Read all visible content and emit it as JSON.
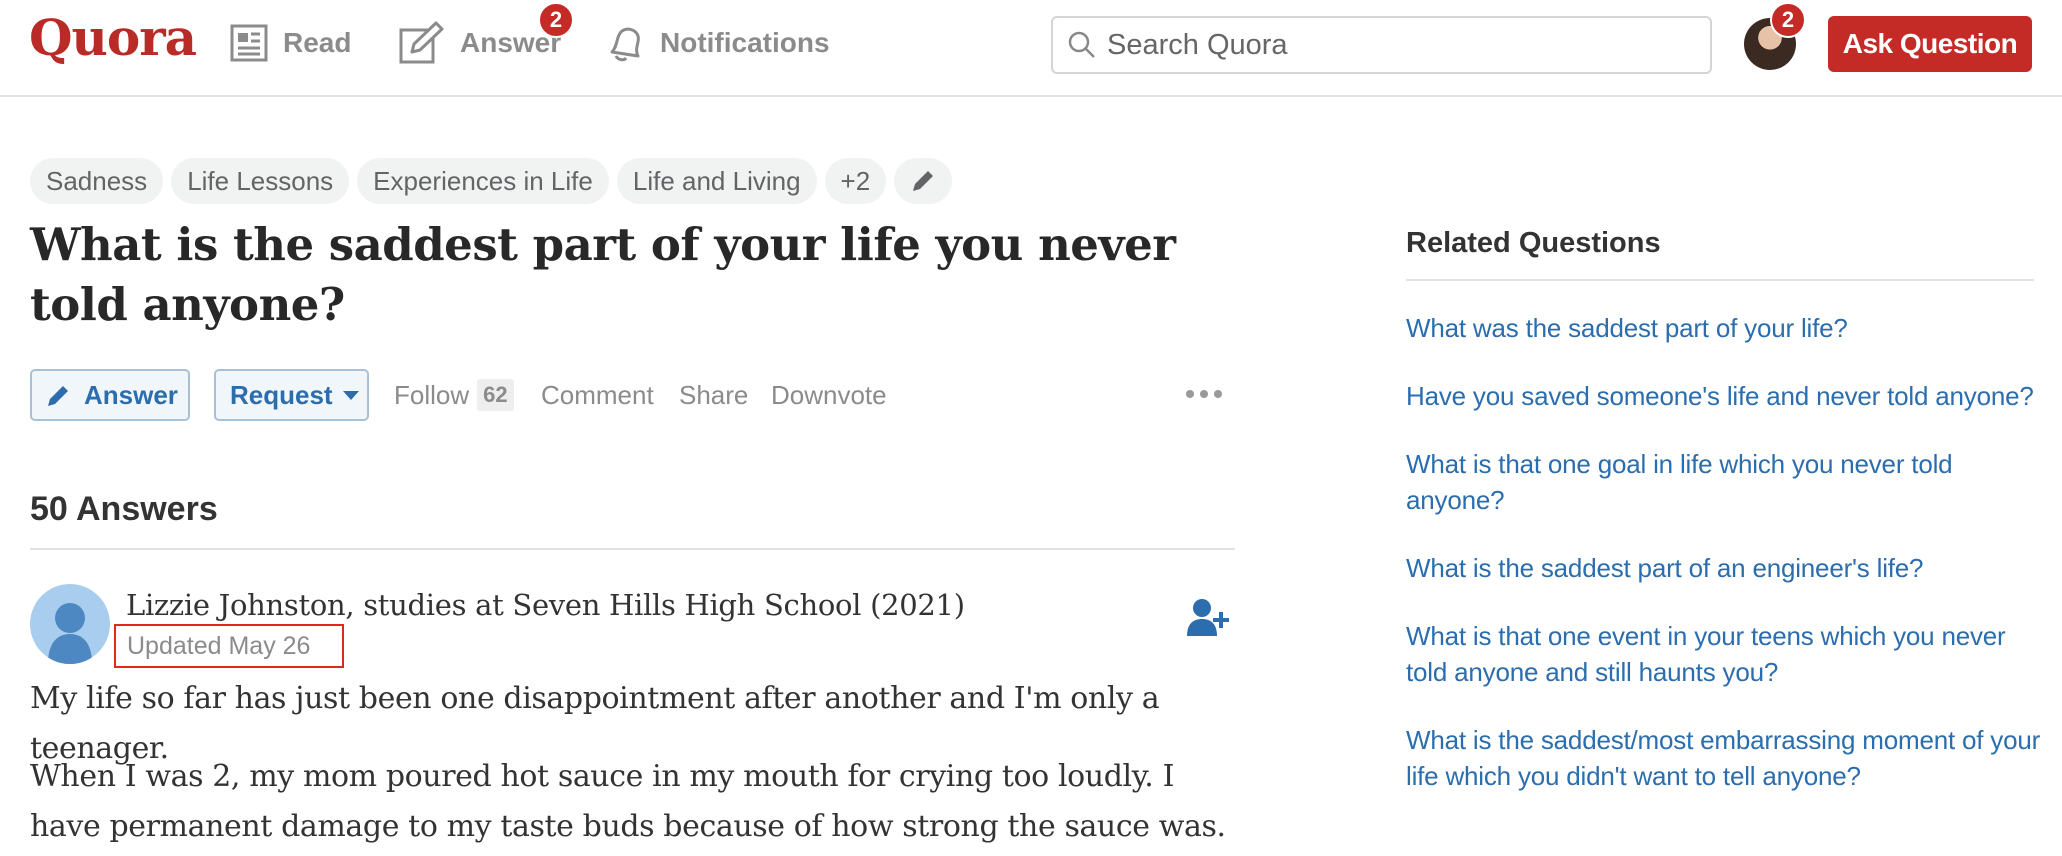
{
  "header": {
    "logo": "Quora",
    "nav": {
      "read": "Read",
      "answer": "Answer",
      "answer_badge": "2",
      "notifications": "Notifications"
    },
    "search_placeholder": "Search Quora",
    "avatar_badge": "2",
    "ask_button": "Ask Question"
  },
  "topics": [
    "Sadness",
    "Life Lessons",
    "Experiences in Life",
    "Life and Living",
    "+2"
  ],
  "question": {
    "title": "What is the saddest part of your life you never told anyone?",
    "actions": {
      "answer": "Answer",
      "request": "Request",
      "follow": "Follow",
      "follow_count": "62",
      "comment": "Comment",
      "share": "Share",
      "downvote": "Downvote"
    },
    "answers_count": "50 Answers"
  },
  "answer": {
    "author": "Lizzie Johnston, studies at Seven Hills High School (2021)",
    "updated": "Updated May 26",
    "paragraphs": [
      "My life so far has just been one disappointment after another and I'm only a teenager.",
      "When I was 2, my mom poured hot sauce in my mouth for crying too loudly. I have permanent damage to my taste buds because of how strong the sauce was."
    ]
  },
  "sidebar": {
    "title": "Related Questions",
    "items": [
      "What was the saddest part of your life?",
      "Have you saved someone's life and never told anyone?",
      "What is that one goal in life which you never told anyone?",
      "What is the saddest part of an engineer's life?",
      "What is that one event in your teens which you never told anyone and still haunts you?",
      "What is the saddest/most embarrassing moment of your life which you didn't want to tell anyone?"
    ]
  },
  "colors": {
    "brand_red": "#b92b27",
    "link_blue": "#2b6dad",
    "highlight_box": "#e0281b"
  },
  "icons": [
    "read-icon",
    "answer-pencil-icon",
    "bell-icon",
    "search-icon",
    "edit-pencil-icon",
    "more-dots-icon",
    "follow-user-icon"
  ]
}
